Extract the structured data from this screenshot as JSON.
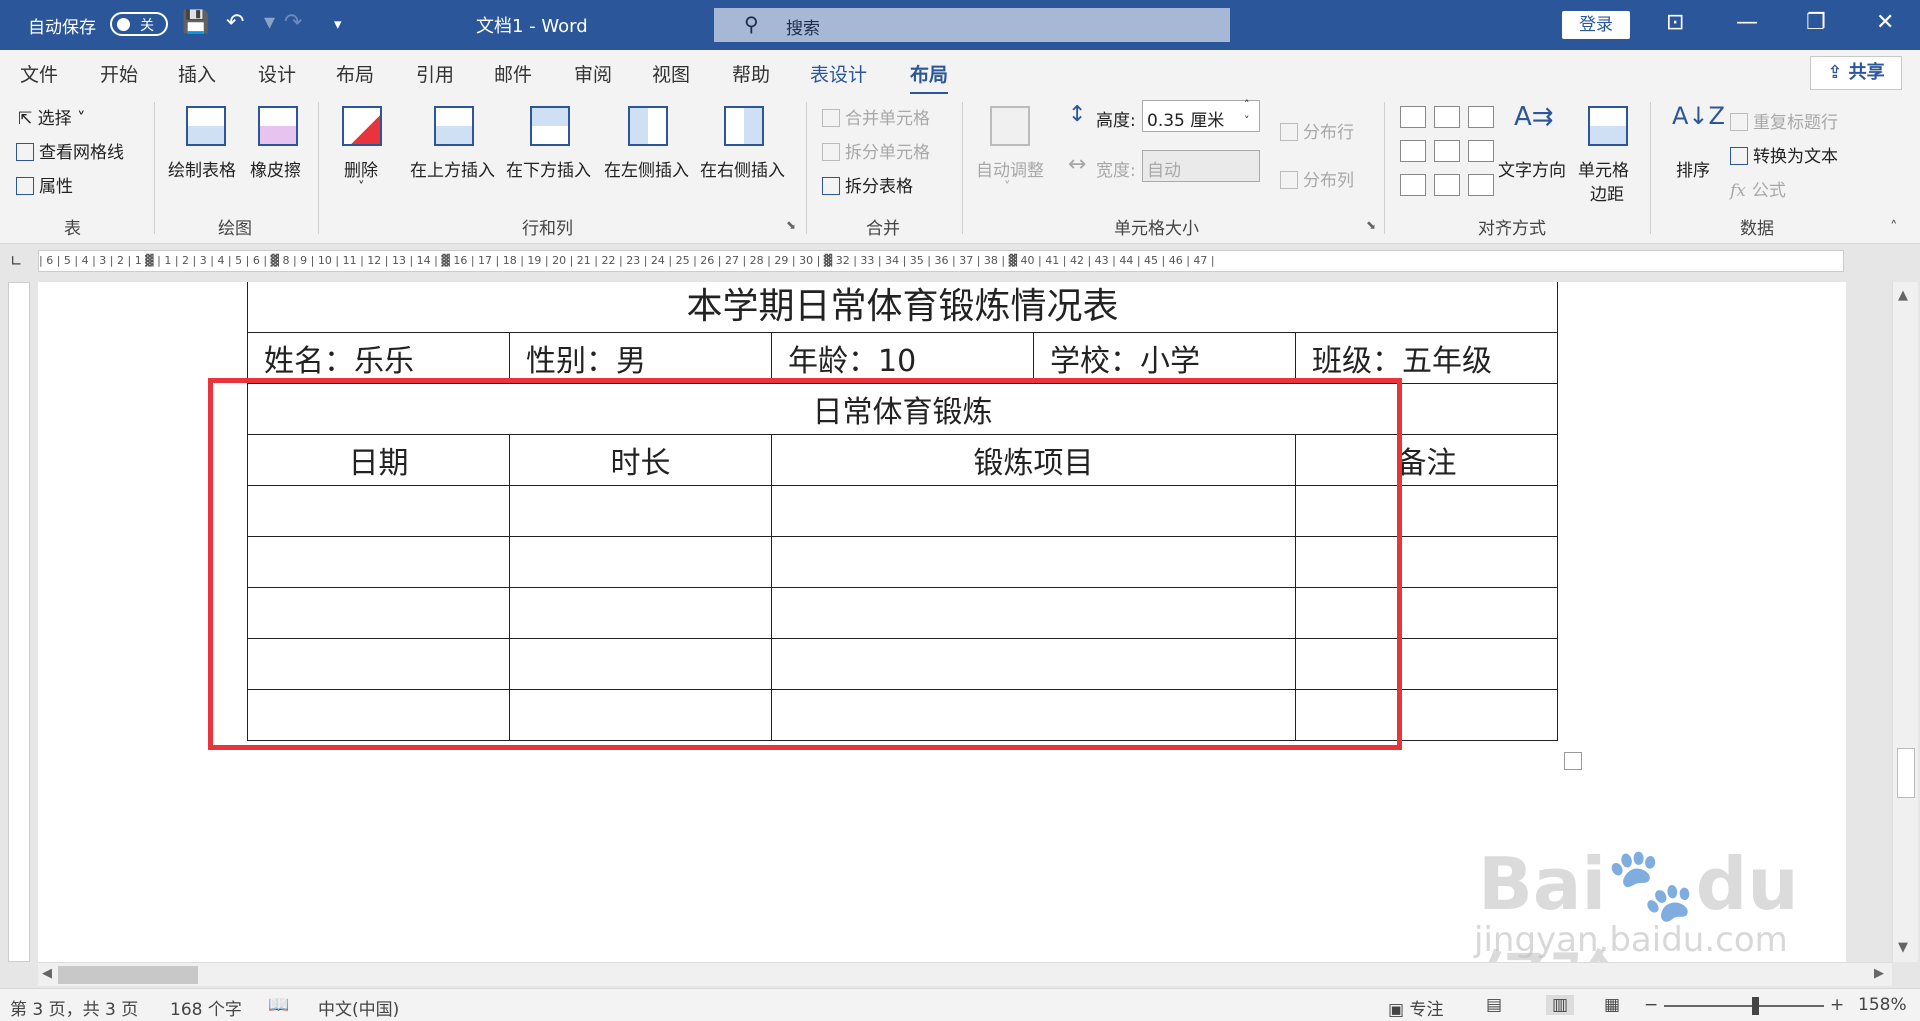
{
  "titlebar": {
    "autosave_label": "自动保存",
    "autosave_state": "关",
    "save_icon": "💾",
    "undo_icon": "↶",
    "redo_icon": "↷",
    "customize_icon": "▾",
    "doc_title": "文档1  -  Word",
    "search_placeholder": "搜索",
    "search_icon": "⚲",
    "login_label": "登录",
    "ribbon_display_icon": "⊡",
    "minimize_icon": "—",
    "restore_icon": "❐",
    "close_icon": "✕"
  },
  "tabs": [
    "文件",
    "开始",
    "插入",
    "设计",
    "布局",
    "引用",
    "邮件",
    "审阅",
    "视图",
    "帮助"
  ],
  "context_tabs": [
    "表设计",
    "布局"
  ],
  "share_label": "⇪ 共享",
  "ribbon": {
    "table_group": {
      "label": "表",
      "select": "选择 ˅",
      "gridlines": "查看网格线",
      "properties": "属性"
    },
    "draw_group": {
      "label": "绘图",
      "draw_table": "绘制表格",
      "eraser": "橡皮擦"
    },
    "rows_cols_group": {
      "label": "行和列",
      "delete": "删除",
      "insert_above": "在上方插入",
      "insert_below": "在下方插入",
      "insert_left": "在左侧插入",
      "insert_right": "在右侧插入"
    },
    "merge_group": {
      "label": "合并",
      "merge_cells": "合并单元格",
      "split_cells": "拆分单元格",
      "split_table": "拆分表格"
    },
    "cell_size_group": {
      "label": "单元格大小",
      "autofit": "自动调整",
      "height_label": "高度:",
      "height_value": "0.35 厘米",
      "width_label": "宽度:",
      "width_value": "自动",
      "distribute_rows": "分布行",
      "distribute_cols": "分布列"
    },
    "alignment_group": {
      "label": "对齐方式",
      "text_direction": "文字方向",
      "cell_margins_1": "单元格",
      "cell_margins_2": "边距"
    },
    "data_group": {
      "label": "数据",
      "sort": "排序",
      "repeat_header": "重复标题行",
      "convert_text": "转换为文本",
      "formula": "公式"
    }
  },
  "ruler_text": "| 6 | 5 | 4 | 3 | 2 | 1 ▓ | 1 | 2 | 3 | 4 | 5 | 6 | ▓ 8 | 9 | 10 | 11 | 12 | 13 | 14 | ▓ 16 | 17 | 18 | 19 | 20 | 21 | 22 | 23 | 24 | 25 | 26 | 27 | 28 | 29 | 30 | ▓ 32 | 33 | 34 | 35 | 36 | 37 | 38 | ▓ 40 | 41 | 42 | 43 | 44 | 45 | 46 | 47 |",
  "document": {
    "title": "本学期日常体育锻炼情况表",
    "info": [
      "姓名：乐乐",
      "性别：男",
      "年龄：10",
      "学校：小学",
      "班级：五年级"
    ],
    "section": "日常体育锻炼",
    "headers": [
      "日期",
      "时长",
      "锻炼项目",
      "备注"
    ]
  },
  "watermark": {
    "line1": "Bai🐾du 经验",
    "line2": "jingyan.baidu.com"
  },
  "status": {
    "page": "第 3 页，共 3 页",
    "words": "168 个字",
    "proof_icon": "📖",
    "language": "中文(中国)",
    "focus": "专注",
    "zoom": "158%",
    "zoom_out": "−",
    "zoom_in": "+"
  }
}
